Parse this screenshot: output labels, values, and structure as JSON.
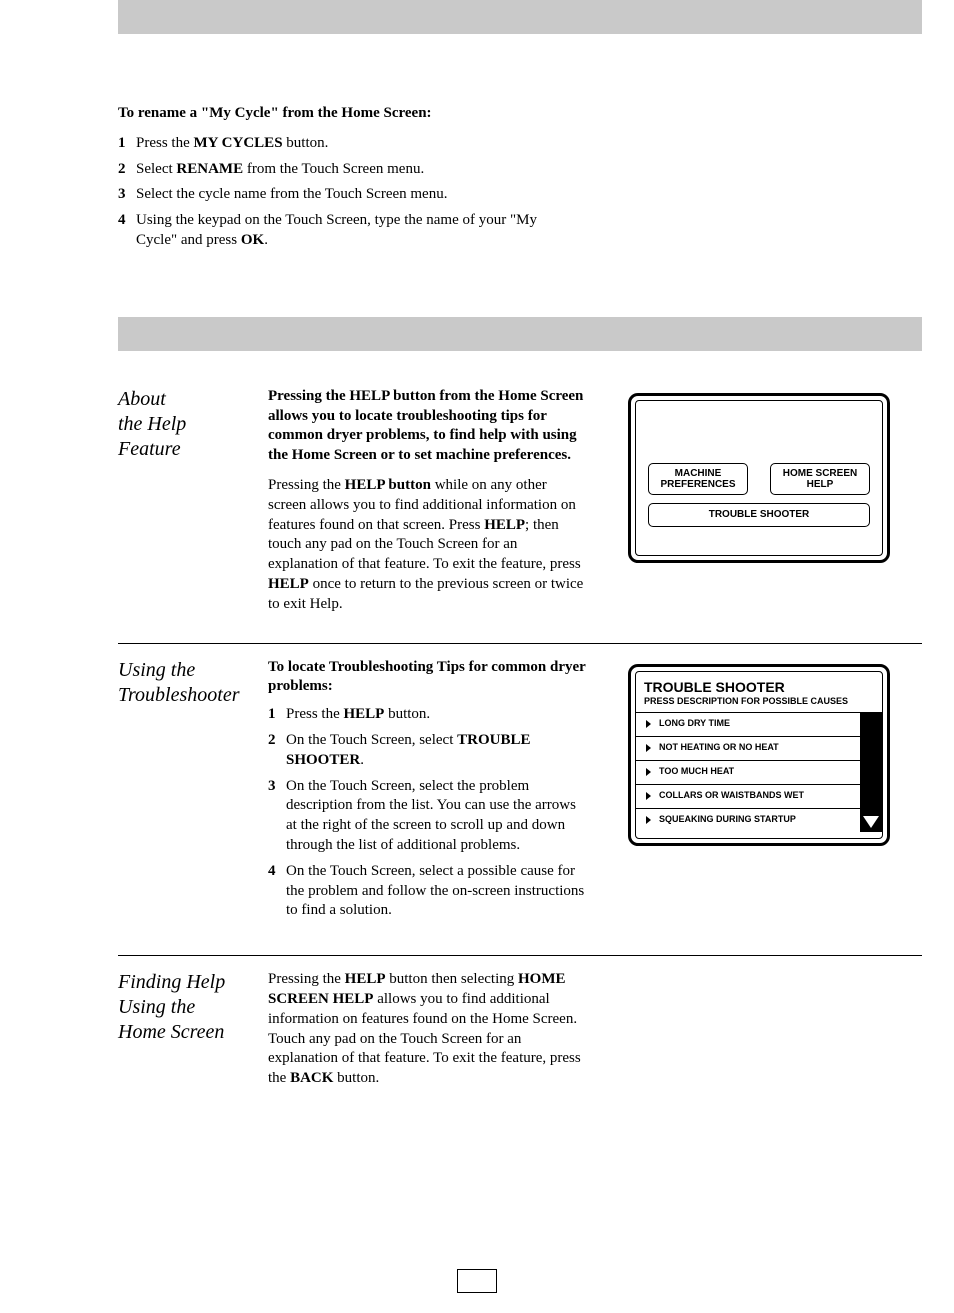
{
  "rename": {
    "heading": "To rename a \"My Cycle\" from the Home Screen:",
    "steps": [
      {
        "pre": "Press the ",
        "bold": "MY CYCLES",
        "post": " button."
      },
      {
        "pre": "Select ",
        "bold": "RENAME",
        "post": " from the Touch Screen menu."
      },
      {
        "pre": "",
        "bold": "",
        "post": "Select the cycle name from the Touch Screen menu."
      },
      {
        "pre": "Using the keypad on the Touch Screen, type the name of your \"My Cycle\" and press ",
        "bold": "OK",
        "post": "."
      }
    ]
  },
  "about_help": {
    "sidehead": "About the Help Feature",
    "p1": "Pressing the HELP button from the Home Screen allows you to locate troubleshooting tips for common dryer problems, to find help with using the Home Screen or to set machine preferences.",
    "p2a": "Pressing the ",
    "p2b": "HELP button",
    "p2c": " while on any other screen allows you to find additional information on features found on that screen. Press ",
    "p2d": "HELP",
    "p2e": "; then touch any pad on the Touch Screen for an explanation of that feature. To exit the feature, press ",
    "p2f": "HELP",
    "p2g": " once to return to the previous screen or twice to exit Help.",
    "screen": {
      "machine_pref": "MACHINE PREFERENCES",
      "home_screen_help": "HOME SCREEN HELP",
      "trouble_shooter": "TROUBLE SHOOTER"
    }
  },
  "using_ts": {
    "sidehead": "Using the Troubleshooter",
    "heading": "To locate Troubleshooting Tips for common dryer problems:",
    "steps": [
      {
        "pre": "Press the ",
        "bold": "HELP",
        "post": " button."
      },
      {
        "pre": "On the Touch Screen, select ",
        "bold": "TROUBLE SHOOTER",
        "post": "."
      },
      {
        "pre": "",
        "bold": "",
        "post": "On the Touch Screen, select the problem description from the list. You can use the arrows at the right of the screen to scroll up and down through the list of additional problems."
      },
      {
        "pre": "",
        "bold": "",
        "post": "On the Touch Screen, select a possible cause for the problem and follow the on-screen instructions to find a solution."
      }
    ],
    "screen": {
      "title": "TROUBLE SHOOTER",
      "subtitle": "PRESS DESCRIPTION FOR POSSIBLE CAUSES",
      "items": [
        "LONG DRY TIME",
        "NOT HEATING OR NO HEAT",
        "TOO MUCH HEAT",
        "COLLARS OR WAISTBANDS WET",
        "SQUEAKING DURING STARTUP"
      ]
    }
  },
  "finding_help": {
    "sidehead": "Finding Help Using the Home Screen",
    "p_a": "Pressing the ",
    "p_b": "HELP",
    "p_c": " button then selecting ",
    "p_d": "HOME SCREEN HELP",
    "p_e": " allows you to find additional information on features found on the Home Screen. Touch any pad on the Touch Screen for an explanation of that feature. To exit the feature, press the ",
    "p_f": "BACK",
    "p_g": " button."
  }
}
